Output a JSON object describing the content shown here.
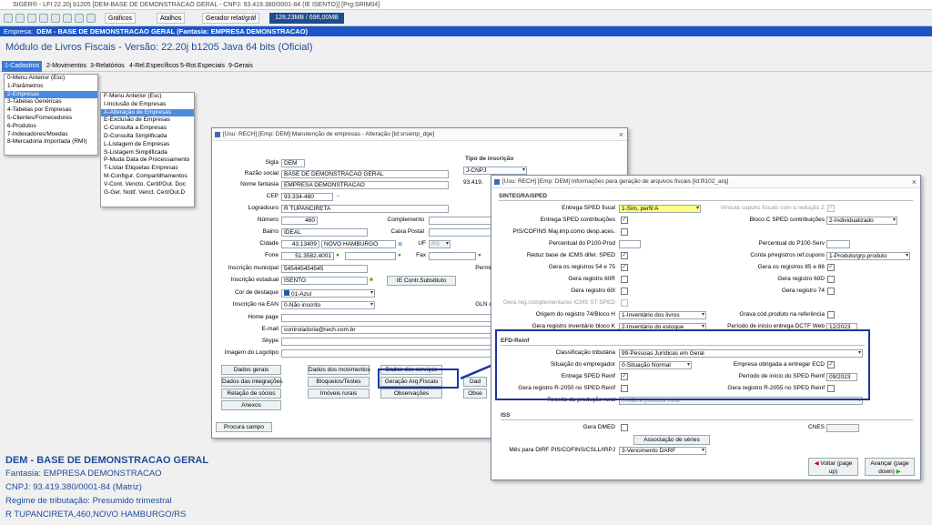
{
  "app": {
    "title": "SIGER® - LFI 22.20j b1205 [DEM-BASE DE DEMONSTRACAO GERAL - CNPJ: 93.419.380/0001-84 (IE ISENTO)] [Prg:SRIM04]",
    "memory": "128,23MB / 696,00MB",
    "toolbar": {
      "graficos": "Gráficos",
      "atalhos": "Atalhos",
      "gerador": "Gerador relat/gráf"
    },
    "empresa_label": "Empresa:",
    "empresa": "DEM - BASE DE DEMONSTRACAO GERAL (Fantasia: EMPRESA DEMONSTRACAO)",
    "module_title": "Módulo de Livros Fiscais - Versão: 22.20j b1205 Java 64 bits (Oficial)"
  },
  "menubar": [
    "1-Cadastros",
    "2-Movimentos",
    "3-Relatórios",
    "4-Rel.Específicos",
    "5-Rot.Especiais",
    "9-Gerais"
  ],
  "menu1": [
    "0-Menu Anterior (Esc)",
    "1-Parâmetros",
    "2-Empresas",
    "3-Tabelas Genéricas",
    "4-Tabelas por Empresas",
    "5-Clientes/Fornecedores",
    "6-Produtos",
    "7-Indexadores/Moedas",
    "8-Mercadoria Importada (RMI)"
  ],
  "menu2": [
    "F-Menu Anterior (Esc)",
    "I-Inclusão de Empresas",
    "A-Alteração de Empresas",
    "E-Exclusão de Empresas",
    "C-Consulta a Empresas",
    "D-Consulta Simplificada",
    "L-Listagem de Empresas",
    "S-Listagem Simplificada",
    "P-Muda Data de Processamento",
    "T-Listar Etiquetas Empresas",
    "M-Configur. Compartilhamentos",
    "V-Cont. Vencto. Certif/Out. Doc",
    "G-Ger. Notif. Venct. Cert/Out.D"
  ],
  "win1": {
    "title": "[Usu: RECH] [Emp: DEM] Manutenção de empresas - Alteração [Id:srsemp_dge]",
    "labels": {
      "sigla": "Sigla",
      "razao": "Razão social",
      "fantasia": "Nome fantasia",
      "cep": "CEP",
      "logradouro": "Logradouro",
      "numero": "Número",
      "complemento": "Complemento",
      "bairro": "Bairro",
      "caixa": "Caixa Postal",
      "cidade": "Cidade",
      "uf": "UF",
      "fone": "Fone",
      "fax": "Fax",
      "im": "Inscrição municipal",
      "permit": "Permit",
      "ie": "Inscrição estadual",
      "cor": "Cor de destaque",
      "ean": "Inscrição na EAN",
      "gln": "GLN d",
      "home": "Home page",
      "email": "E-mail",
      "skype": "Skype",
      "logotipo": "Imagem do Logotipo",
      "tipo_inscricao": "Tipo de inscrição"
    },
    "values": {
      "sigla": "DEM",
      "razao": "BASE DE DEMONSTRACAO GERAL",
      "fantasia": "EMPRESA DEMONSTRACAO",
      "cep": "93.334-480",
      "logradouro": "R TUPANCIRETA",
      "numero": "460",
      "bairro": "IDEAL",
      "cidade_cod": "43.13409",
      "cidade": "NOVO HAMBURGO",
      "uf": "RS",
      "fone": "51.3582.4001",
      "im": "545445454545",
      "ie": "ISENTO",
      "cor": "01-Azul",
      "ean": "0-Não inscrito",
      "email": "controladoria@rech.com.br",
      "tipo": "J-CNPJ",
      "cnpj": "93.419."
    },
    "buttons": {
      "ie_subst": "IE Contr.Substituto",
      "dados_gerais": "Dados gerais",
      "dados_mov": "Dados dos movimentos",
      "dados_serv": "Dados dos serviços",
      "integracoes": "Dados das integrações",
      "bloqueios": "Bloqueios/Testes",
      "geracao": "Geração Arq.Fiscais",
      "relacao": "Relação de sócios",
      "imoveis": "Imóveis rurais",
      "observacoes": "Observações",
      "anexos": "Anexos",
      "procura": "Procura campo",
      "dad": "Dad",
      "obs": "Obse"
    }
  },
  "win2": {
    "title": "[Usu: RECH] [Emp: DEM] Informações para geração de arquivos fiscais [Id:lfi102_arq]",
    "sec_sintegra": "SINTEGRA/SPED",
    "sec_reinf": "EFD-Reinf",
    "sec_iss": "ISS",
    "l": {
      "entrega_sped": "Entrega SPED fiscal",
      "entrega_contrib": "Entrega SPED contribuições",
      "pis": "PIS/COFINS Maj.imp.como desp.aces.",
      "perc_prod": "Percentual do P100-Prod",
      "reduz": "Reduz base de ICMS difer. SPED",
      "reg54": "Gera os registros 54 e 75",
      "reg60r": "Gera registro 60R",
      "reg60i": "Gera registro 60I",
      "gera_reg": "Gera reg.complementares ICMS ST SPED",
      "origem": "Origem do registro 74/Bloco H",
      "inventario": "Gera registro inventário bloco K",
      "vincula": "Vincula cupons fiscais com a redução Z",
      "blococ": "Bloco C SPED contribuições",
      "perc_serv": "Percentual do P100-Serv",
      "conta": "Conta p/registros ref.cupons",
      "reg85": "Gera os registros 85 e 86",
      "reg60d": "Gera registro 60D",
      "reg74": "Gera registro 74",
      "grava": "Grava cód.produto na referência",
      "periodo_dctf": "Período de início entrega DCTF Web",
      "classif": "Classificação tributária",
      "situacao": "Situação do empregador",
      "entrega_reinf": "Entrega SPED Reinf",
      "r2050": "Gera registro R-2050 no SPED Reinf",
      "receita": "Receita da produção rural",
      "obrigada": "Empresa obrigada a entregar ECD",
      "periodo_reinf": "Período de início do SPED Reinf",
      "r2055": "Gera registro R-2055 no SPED Reinf",
      "dmed": "Gera DMED",
      "cnes": "CNES",
      "dirf": "Mês para DIRF PIS/COFINS/CSLL/IRPJ"
    },
    "v": {
      "entrega_sped": "1-Sim, perfil A",
      "blococ": "2-Individualizado",
      "conta": "1-Produto/grp.produto",
      "origem": "1-Inventário dos livros",
      "inventario": "2-Inventário do estoque",
      "periodo_dctf": "12/2023",
      "classif": "99-Pessoas Jurídicas em Geral",
      "situacao": "0-Situação Normal",
      "periodo_reinf": "09/2023",
      "receita": "0-Não é produtor rural",
      "dirf": "3-Vencimento DARF"
    },
    "b": {
      "assoc": "Associação de séries",
      "voltar": "Voltar (page up)",
      "avancar": "Avançar (page down)"
    }
  },
  "info": {
    "title": "DEM - BASE DE DEMONSTRACAO GERAL",
    "l1": "Fantasia: EMPRESA DEMONSTRACAO",
    "l2": "CNPJ: 93.419.380/0001-84 (Matriz)",
    "l3": "Regime de tributação: Presumido trimestral",
    "l4": "R TUPANCIRETA,460,NOVO HAMBURGO/RS"
  }
}
